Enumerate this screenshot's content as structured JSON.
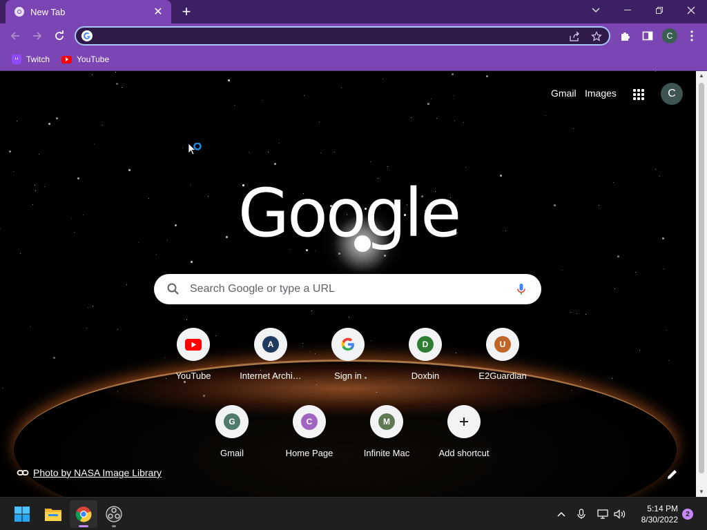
{
  "browser": {
    "tab": {
      "title": "New Tab"
    },
    "omnibox": {
      "value": "",
      "placeholder": ""
    },
    "profile_initial": "C",
    "bookmarks": [
      {
        "label": "Twitch",
        "icon": "twitch-icon",
        "color": "#9146ff"
      },
      {
        "label": "YouTube",
        "icon": "youtube-icon",
        "color": "#ff0000"
      }
    ]
  },
  "ntp": {
    "top_links": {
      "gmail": "Gmail",
      "images": "Images"
    },
    "avatar_initial": "C",
    "logo": "Google",
    "search_placeholder": "Search Google or type a URL",
    "shortcuts": [
      {
        "label": "YouTube",
        "icon": "youtube-icon"
      },
      {
        "label": "Internet Archi…",
        "letter": "A",
        "color": "#1e3a5f"
      },
      {
        "label": "Sign in",
        "icon": "google-g-icon"
      },
      {
        "label": "Doxbin",
        "letter": "D",
        "color": "#2e7d32"
      },
      {
        "label": "E2Guardian",
        "letter": "U",
        "color": "#c0652a"
      },
      {
        "label": "Gmail",
        "letter": "G",
        "color": "#4f7b6a"
      },
      {
        "label": "Home Page",
        "letter": "C",
        "color": "#a065c0"
      },
      {
        "label": "Infinite Mac",
        "letter": "M",
        "color": "#5f7a50"
      },
      {
        "label": "Add shortcut",
        "icon": "plus-icon"
      }
    ],
    "attribution": "Photo by NASA Image Library"
  },
  "taskbar": {
    "time": "5:14 PM",
    "date": "8/30/2022",
    "notification_count": "2"
  }
}
